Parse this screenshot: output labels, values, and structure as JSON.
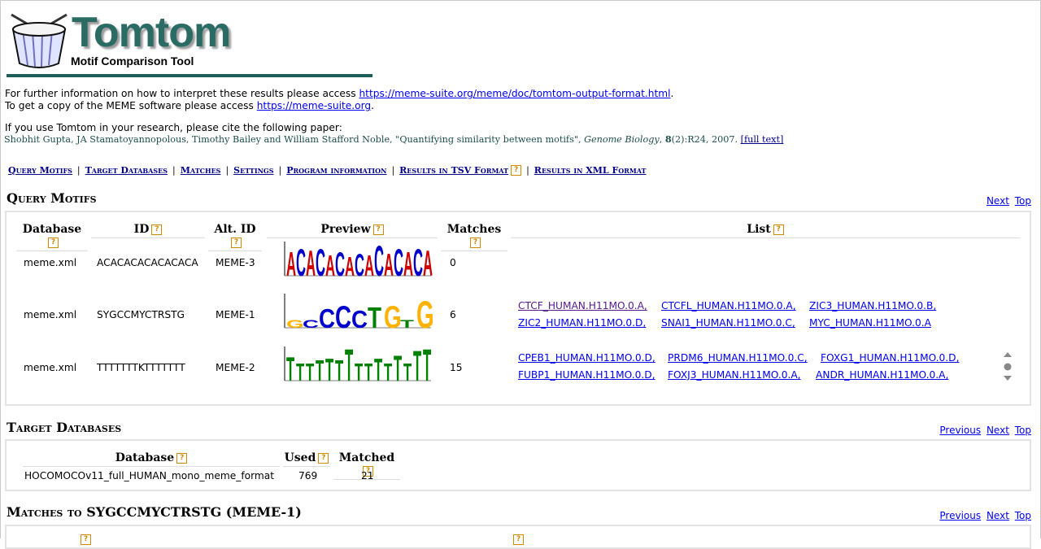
{
  "header": {
    "title": "Tomtom",
    "subtitle": "Motif Comparison Tool"
  },
  "info": {
    "line1_text": "For further information on how to interpret these results please access",
    "line1_link": "https://meme-suite.org/meme/doc/tomtom-output-format.html",
    "line1_end": ".",
    "line2_text": "To get a copy of the MEME software please access",
    "line2_link": "https://meme-suite.org",
    "line2_end": "."
  },
  "citation": {
    "intro": "If you use Tomtom in your research, please cite the following paper:",
    "authors": "Shobhit Gupta, JA Stamatoyannopolous, Timothy Bailey and William Stafford Noble, \"Quantifying similarity between motifs\", ",
    "journal": "Genome Biology",
    "comma": ", ",
    "volume": "8",
    "rest": "(2):R24, 2007. ",
    "link": "[full text]"
  },
  "nav": {
    "query_motifs": "Query Motifs",
    "target_databases": "Target Databases",
    "matches": "Matches",
    "settings": "Settings",
    "program_information": "Program information",
    "tsv": "Results in TSV Format",
    "xml": "Results in XML Format",
    "sep": "|"
  },
  "help_glyph": "?",
  "query_section": {
    "title": "Query Motifs",
    "next": "Next",
    "top": "Top",
    "headers": {
      "database": "Database",
      "id": "ID",
      "alt_id": "Alt. ID",
      "preview": "Preview",
      "matches": "Matches",
      "list": "List"
    },
    "rows": [
      {
        "database": "meme.xml",
        "id": "ACACACACACACACA",
        "alt_id": "MEME-3",
        "matches": "0",
        "links": []
      },
      {
        "database": "meme.xml",
        "id": "SYGCCMYCTRSTG",
        "alt_id": "MEME-1",
        "matches": "6",
        "links": [
          "CTCF_HUMAN.H11MO.0.A,",
          "CTCFL_HUMAN.H11MO.0.A,",
          "ZIC3_HUMAN.H11MO.0.B,",
          "ZIC2_HUMAN.H11MO.0.D,",
          "SNAI1_HUMAN.H11MO.0.C,",
          "MYC_HUMAN.H11MO.0.A"
        ]
      },
      {
        "database": "meme.xml",
        "id": "TTTTTTTKTTTTTTT",
        "alt_id": "MEME-2",
        "matches": "15",
        "links": [
          "CPEB1_HUMAN.H11MO.0.D,",
          "PRDM6_HUMAN.H11MO.0.C,",
          "FOXG1_HUMAN.H11MO.0.D,",
          "FUBP1_HUMAN.H11MO.0.D,",
          "FOXJ3_HUMAN.H11MO.0.A,",
          "ANDR_HUMAN.H11MO.0.A,"
        ]
      }
    ]
  },
  "logos": {
    "row1": "ACACACACACACACA",
    "row2": "GCCCCTGTG",
    "row3": "TTTTTTTTTTTTTTT"
  },
  "target_section": {
    "title": "Target Databases",
    "previous": "Previous",
    "next": "Next",
    "top": "Top",
    "headers": {
      "database": "Database",
      "used": "Used",
      "matched": "Matched"
    },
    "row": {
      "database": "HOCOMOCOv11_full_HUMAN_mono_meme_format",
      "used": "769",
      "matched": "21"
    }
  },
  "matches_section": {
    "title": "Matches to SYGCCMYCTRSTG (MEME-1)",
    "previous": "Previous",
    "next": "Next",
    "top": "Top"
  },
  "colors": {
    "A": "#cc0000",
    "C": "#0000cc",
    "G": "#ffb300",
    "T": "#008000",
    "brand": "#2a6b63"
  }
}
